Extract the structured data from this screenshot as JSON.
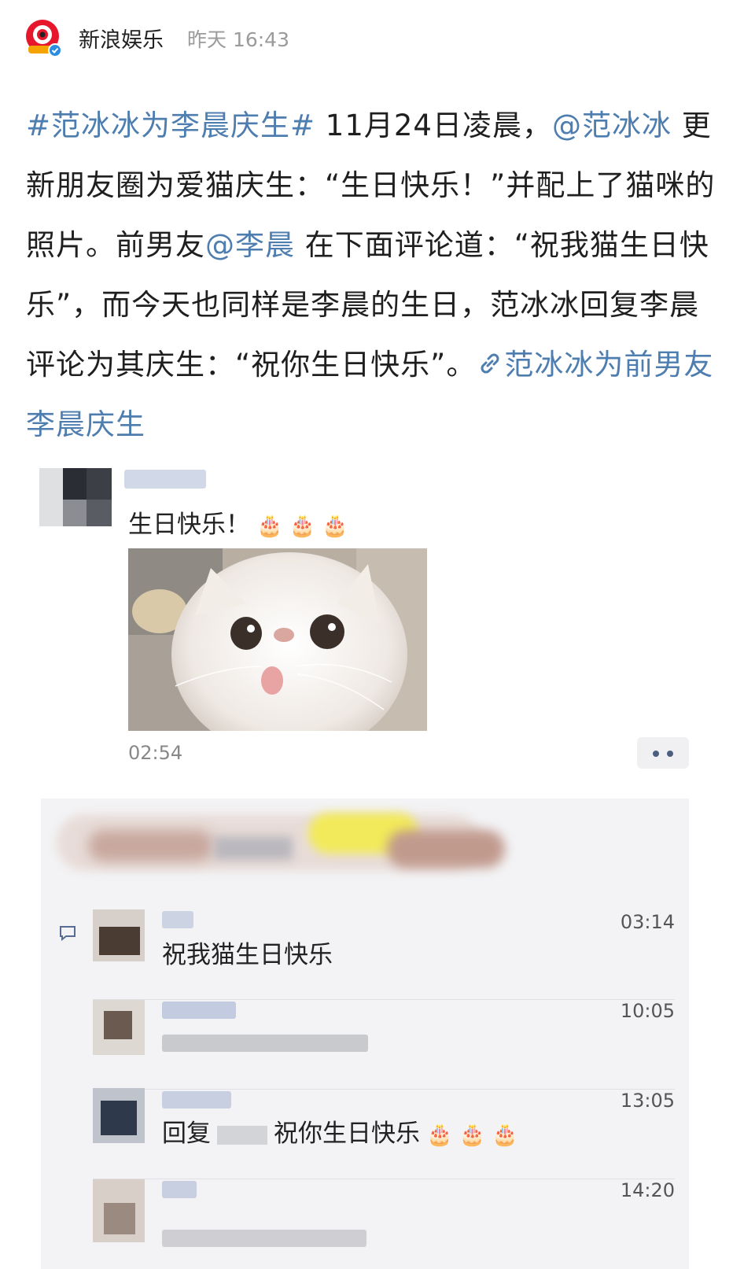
{
  "header": {
    "username": "新浪娱乐",
    "time": "昨天 16:43"
  },
  "post": {
    "hashtag": "#范冰冰为李晨庆生#",
    "text1": " 11月24日凌晨，",
    "mention1": "@范冰冰",
    "text2": " 更新朋友圈为爱猫庆生：“生日快乐！”并配上了猫咪的照片。前男友",
    "mention2": "@李晨",
    "text3": " 在下面评论道：“祝我猫生日快乐”，而今天也同样是李晨的生日，范冰冰回复李晨评论为其庆生：“祝你生日快乐”。",
    "link_text": "范冰冰为前男友李晨庆生"
  },
  "moments": {
    "post_text": "生日快乐！",
    "cake_emoji": "🎂",
    "post_time": "02:54",
    "comments": [
      {
        "time": "03:14",
        "text": "祝我猫生日快乐"
      },
      {
        "time": "10:05",
        "text": ""
      },
      {
        "time": "13:05",
        "text_prefix": "回复",
        "text": "祝你生日快乐"
      },
      {
        "time": "14:20",
        "text": ""
      }
    ]
  },
  "colors": {
    "link": "#4e7db0",
    "brand": "#e6162d"
  }
}
